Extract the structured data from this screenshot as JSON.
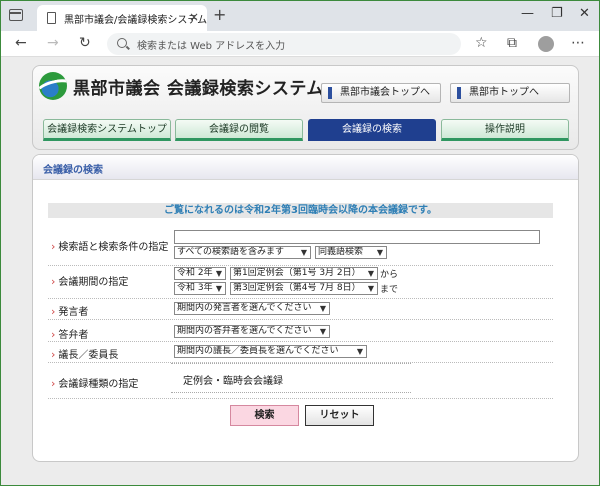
{
  "browser": {
    "tab_title": "黒部市議会/会議録検索システム",
    "tab_close": "×",
    "new_tab": "+",
    "address_placeholder": "検索または Web アドレスを入力",
    "window_controls": [
      "—",
      "❐",
      "✕"
    ],
    "nav_icons": [
      "←",
      "→",
      "↻"
    ],
    "toolbar_icons": [
      "☆",
      "⧉",
      "⋯"
    ]
  },
  "header": {
    "site_title": "黒部市議会 会議録検索システム",
    "top_buttons": [
      "黒部市議会トップへ",
      "黒部市トップへ"
    ],
    "tabs": [
      {
        "label": "会議録検索システムトップ",
        "active": false
      },
      {
        "label": "会議録の閲覧",
        "active": false
      },
      {
        "label": "会議録の検索",
        "active": true
      },
      {
        "label": "操作説明",
        "active": false
      }
    ]
  },
  "panel": {
    "title": "会議録の検索",
    "notice": "ご覧になれるのは令和2年第3回臨時会以降の本会議録です。",
    "rows": {
      "keyword": {
        "label": "検索語と検索条件の指定",
        "input_value": "",
        "condition": "すべての検索語を含みます",
        "synonym": "同義語検索"
      },
      "period": {
        "label": "会議期間の指定",
        "from_year": "令和 2年",
        "from_session": "第1回定例会（第1号 3月 2日）",
        "from_suffix": "から",
        "to_year": "令和 3年",
        "to_session": "第3回定例会（第4号 7月 8日）",
        "to_suffix": "まで"
      },
      "speaker": {
        "label": "発言者",
        "value": "期間内の発言者を選んでください"
      },
      "answerer": {
        "label": "答弁者",
        "value": "期間内の答弁者を選んでください"
      },
      "chair": {
        "label": "議長／委員長",
        "value": "期間内の議長／委員長を選んでください"
      },
      "kind": {
        "label": "会議録種類の指定",
        "value": "定例会・臨時会会議録"
      }
    },
    "buttons": {
      "search": "検索",
      "reset": "リセット"
    }
  },
  "colors": {
    "accent_blue": "#1f3f8f",
    "tab_green": "#2f9660",
    "notice_blue": "#2f7fb5",
    "search_button_pink": "#fbd7e2"
  }
}
